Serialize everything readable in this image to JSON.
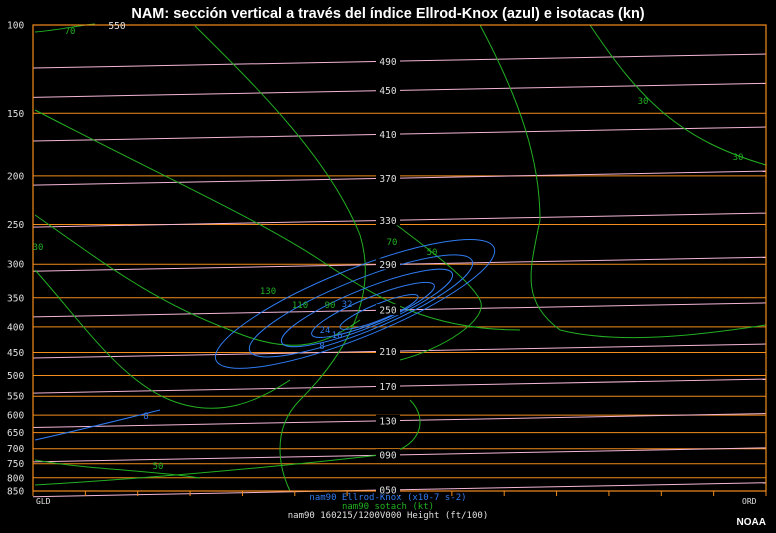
{
  "title": "NAM: sección vertical a través del índice Ellrod-Knox (azul) e isotacas (kn)",
  "credit": "NOAA",
  "legend": {
    "ellrod": "nam90 Ellrod-Knox (x10-7 s-2)",
    "isotach": "nam90 sotach (kt)",
    "height": "nam90 160215/1200V000 Height (ft/100)"
  },
  "stations": {
    "left": "GLD",
    "right": "ORD"
  },
  "colors": {
    "background": "#000000",
    "axis": "#f28c1a",
    "pressure_lines": "#f28c1a",
    "height_lines": "#f4b6d6",
    "ellrod": "#2f7bf0",
    "isotach": "#22b022",
    "title": "#ffffff"
  },
  "chart_data": {
    "type": "contour",
    "title": "NAM: sección vertical a través del índice Ellrod-Knox (azul) e isotacas (kn)",
    "y_axis": {
      "label": "",
      "scale": "log-pressure (inverted)",
      "ticks": [
        100,
        150,
        200,
        250,
        300,
        350,
        400,
        450,
        500,
        550,
        600,
        650,
        700,
        750,
        800,
        850
      ],
      "range": [
        100,
        850
      ]
    },
    "x_axis": {
      "label": "",
      "start": "GLD",
      "end": "ORD"
    },
    "grid": true,
    "height_contours_ft100": [
      {
        "label": "490",
        "p": 118
      },
      {
        "label": "450",
        "p": 135
      },
      {
        "label": "410",
        "p": 165
      },
      {
        "label": "370",
        "p": 202
      },
      {
        "label": "330",
        "p": 245
      },
      {
        "label": "290",
        "p": 300
      },
      {
        "label": "250",
        "p": 370
      },
      {
        "label": "210",
        "p": 447
      },
      {
        "label": "170",
        "p": 525
      },
      {
        "label": "130",
        "p": 615
      },
      {
        "label": "090",
        "p": 720
      },
      {
        "label": "050",
        "p": 845
      }
    ],
    "ellrod_knox_labels": [
      "8",
      "16",
      "24",
      "32",
      "8"
    ],
    "isotach_labels_kt": [
      "70",
      "90",
      "110",
      "130",
      "70",
      "50",
      "30",
      "50",
      "30",
      "30"
    ],
    "extra_labels": [
      "550"
    ]
  }
}
